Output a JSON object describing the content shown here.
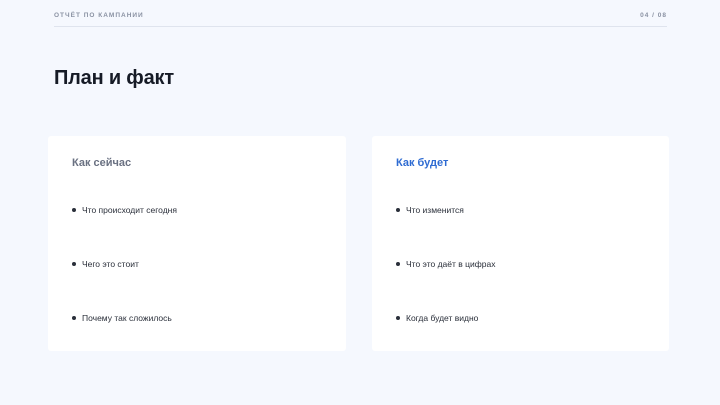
{
  "header": {
    "label": "ОТЧЁТ ПО КАМПАНИИ",
    "page_indicator": "04 / 08"
  },
  "title": "План и факт",
  "columns": {
    "current": {
      "heading": "Как сейчас",
      "items": [
        "Что происходит сегодня",
        "Чего это стоит",
        "Почему так сложилось"
      ]
    },
    "future": {
      "heading": "Как будет",
      "items": [
        "Что изменится",
        "Что это даёт в цифрах",
        "Когда будет видно"
      ]
    }
  },
  "colors": {
    "background": "#f5f8fe",
    "card": "#ffffff",
    "accent": "#2e6bd2",
    "muted": "#6a7182"
  }
}
